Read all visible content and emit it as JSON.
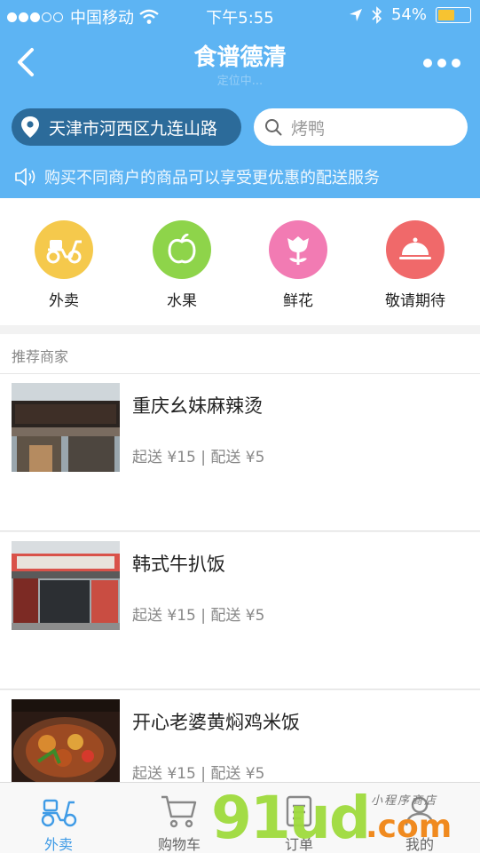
{
  "status_bar": {
    "carrier": "中国移动",
    "time": "下午5:55",
    "battery": "54%",
    "battery_level": 0.54
  },
  "header": {
    "title": "食谱德清",
    "subtitle": "定位中..."
  },
  "location": {
    "address": "天津市河西区九连山路"
  },
  "search": {
    "placeholder": "烤鸭"
  },
  "notice": "购买不同商户的商品可以享受更优惠的配送服务",
  "categories": [
    {
      "label": "外卖",
      "color": "#f5c94c",
      "icon": "scooter-icon"
    },
    {
      "label": "水果",
      "color": "#8ed44a",
      "icon": "apple-icon"
    },
    {
      "label": "鲜花",
      "color": "#f27bb3",
      "icon": "flower-icon"
    },
    {
      "label": "敬请期待",
      "color": "#f0696a",
      "icon": "cloche-icon"
    }
  ],
  "section_title": "推荐商家",
  "merchants": [
    {
      "name": "重庆幺妹麻辣烫",
      "info": "起送 ¥15 | 配送 ¥5",
      "thumb_icon": "storefront-photo"
    },
    {
      "name": "韩式牛扒饭",
      "info": "起送 ¥15 | 配送 ¥5",
      "thumb_icon": "storefront-photo"
    },
    {
      "name": "开心老婆黄焖鸡米饭",
      "info": "起送 ¥15 | 配送 ¥5",
      "thumb_icon": "food-photo"
    }
  ],
  "tabs": [
    {
      "label": "外卖",
      "icon": "scooter-icon",
      "active": true
    },
    {
      "label": "购物车",
      "icon": "cart-icon",
      "active": false
    },
    {
      "label": "订单",
      "icon": "order-icon",
      "active": false
    },
    {
      "label": "我的",
      "icon": "user-icon",
      "active": false
    }
  ],
  "watermark": {
    "main": "91ud",
    "domain": ".com",
    "small": "小程序商店"
  },
  "colors": {
    "primary": "#5db4f3",
    "location_pill": "#2c6b9a",
    "tab_active": "#3f9be6"
  }
}
